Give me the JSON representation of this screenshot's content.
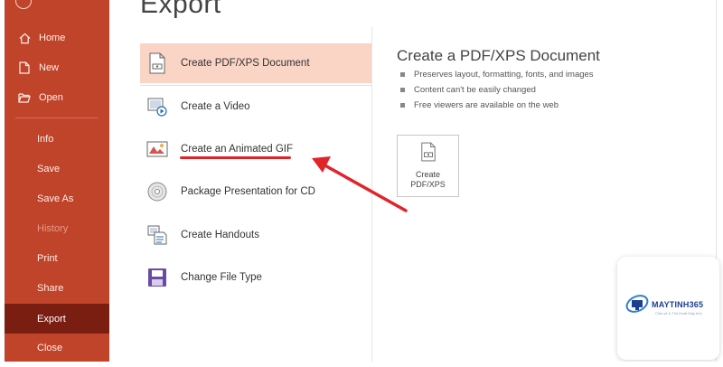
{
  "backstage": {
    "title": "Export",
    "accent_color": "#c0442a",
    "active_color": "#7a1e12",
    "nav": [
      {
        "label": "Home",
        "icon": "home-icon"
      },
      {
        "label": "New",
        "icon": "new-document-icon"
      },
      {
        "label": "Open",
        "icon": "folder-open-icon"
      },
      {
        "label": "Info"
      },
      {
        "label": "Save"
      },
      {
        "label": "Save As"
      },
      {
        "label": "History"
      },
      {
        "label": "Print"
      },
      {
        "label": "Share"
      },
      {
        "label": "Export"
      },
      {
        "label": "Close"
      }
    ]
  },
  "export_options": [
    {
      "label": "Create PDF/XPS Document",
      "icon": "pdf-document-icon"
    },
    {
      "label": "Create a Video",
      "icon": "video-icon"
    },
    {
      "label": "Create an Animated GIF",
      "icon": "animated-gif-icon"
    },
    {
      "label": "Package Presentation for CD",
      "icon": "cd-disc-icon"
    },
    {
      "label": "Create Handouts",
      "icon": "handouts-icon"
    },
    {
      "label": "Change File Type",
      "icon": "change-file-type-icon"
    }
  ],
  "detail": {
    "title": "Create a PDF/XPS Document",
    "bullets": [
      "Preserves layout, formatting, fonts, and images",
      "Content can't be easily changed",
      "Free viewers are available on the web"
    ],
    "button_line1": "Create",
    "button_line2": "PDF/XPS"
  },
  "watermark": {
    "brand": "MAYTINH365",
    "tagline": "Chia sẻ & Thủ thuật Máy tính"
  },
  "annotation_color": "#e0242a"
}
